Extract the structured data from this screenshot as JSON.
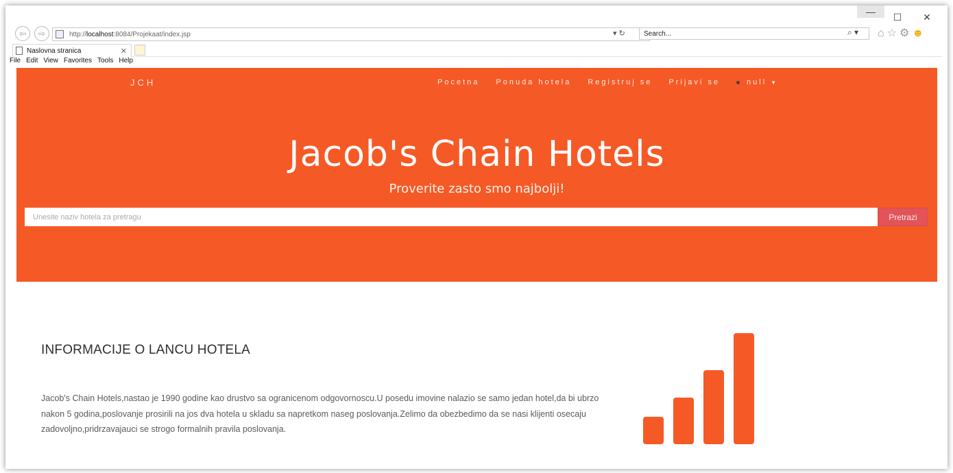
{
  "browser": {
    "window_controls": {
      "minimize": "—",
      "maximize": "☐",
      "close": "✕"
    },
    "address": {
      "prefix": "http://",
      "host": "localhost",
      "rest": ":8084/Projekaat/index.jsp"
    },
    "search_placeholder": "Search...",
    "tab_title": "Naslovna stranica",
    "menu": [
      "File",
      "Edit",
      "View",
      "Favorites",
      "Tools",
      "Help"
    ]
  },
  "site": {
    "brand": "JCH",
    "nav": [
      "Pocetna",
      "Ponuda hotela",
      "Registruj se",
      "Prijavi se"
    ],
    "user_label": "null",
    "title": "Jacob's Chain Hotels",
    "subtitle": "Proverite zasto smo najbolji!",
    "search_placeholder": "Unesite naziv hotela za pretragu",
    "search_button": "Pretrazi",
    "info_title": "INFORMACIJE O LANCU HOTELA",
    "info_text": "Jacob's Chain Hotels,nastao je 1990 godine kao drustvo sa ogranicenom odgovornoscu.U posedu imovine nalazio se samo jedan hotel,da bi ubrzo nakon 5 godina,poslovanje prosirili na jos dva hotela u skladu sa napretkom naseg poslovanja.Zelimo da obezbedimo da se nasi klijenti osecaju zadovoljno,pridrzavajauci se strogo formalnih pravila poslovanja.",
    "icon": "signal-bars-icon"
  },
  "colors": {
    "accent": "#f55a26",
    "button": "#e2535a"
  }
}
